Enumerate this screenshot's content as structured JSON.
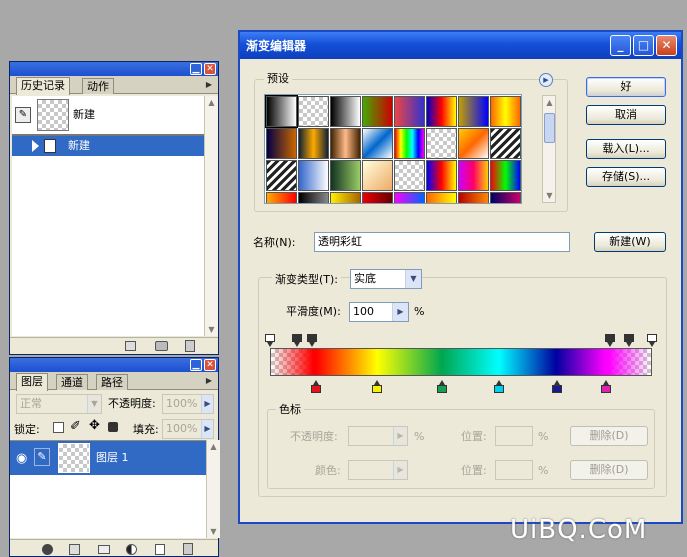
{
  "history_panel": {
    "tabs": [
      "历史记录",
      "动作"
    ],
    "snapshot_label": "新建",
    "items": [
      {
        "label": "新建"
      }
    ]
  },
  "layers_panel": {
    "tabs": [
      "图层",
      "通道",
      "路径"
    ],
    "blend_mode": "正常",
    "opacity_label": "不透明度:",
    "opacity_value": "100%",
    "lock_label": "锁定:",
    "fill_label": "填充:",
    "fill_value": "100%",
    "layers": [
      {
        "name": "图层 1"
      }
    ]
  },
  "dialog": {
    "title": "渐变编辑器",
    "preset_label": "预设",
    "buttons": {
      "ok": "好",
      "cancel": "取消",
      "load": "载入(L)...",
      "save": "存储(S)...",
      "new": "新建(W)",
      "delete1": "删除(D)",
      "delete2": "删除(D)"
    },
    "name_label": "名称(N):",
    "name_value": "透明彩虹",
    "type_label": "渐变类型(T):",
    "type_value": "实底",
    "smooth_label": "平滑度(M):",
    "smooth_value": "100",
    "percent": "%",
    "color_stops_label": "色标",
    "opacity_label": "不透明度:",
    "location_label": "位置:",
    "color_label": "颜色:",
    "location_label2": "位置:",
    "percent2": "%",
    "percent3": "%"
  },
  "gradient": {
    "colors": [
      "#ff0000",
      "#ffff00",
      "#00a651",
      "#00ffff",
      "#0000a0",
      "#ff00ff"
    ],
    "color_stops": [
      {
        "location": 12,
        "color": "#e8101c"
      },
      {
        "location": 28,
        "color": "#f7f000"
      },
      {
        "location": 45,
        "color": "#14a050"
      },
      {
        "location": 60,
        "color": "#00d0f0"
      },
      {
        "location": 75,
        "color": "#1a1a8c"
      },
      {
        "location": 88,
        "color": "#e020b0"
      }
    ],
    "opacity_stops": [
      0,
      7,
      11,
      89,
      94,
      100
    ]
  },
  "watermark": "UiBQ.CoM"
}
